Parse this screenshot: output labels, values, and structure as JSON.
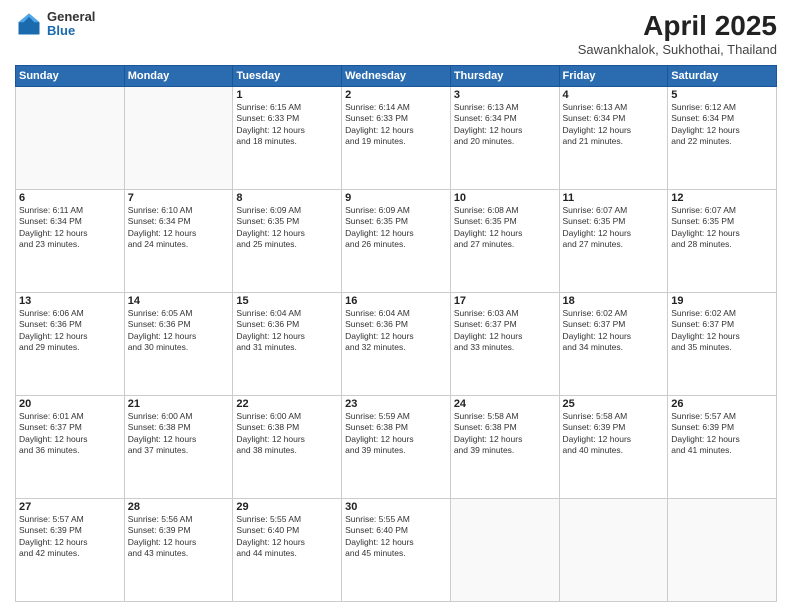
{
  "logo": {
    "general": "General",
    "blue": "Blue"
  },
  "header": {
    "title": "April 2025",
    "subtitle": "Sawankhalok, Sukhothai, Thailand"
  },
  "weekdays": [
    "Sunday",
    "Monday",
    "Tuesday",
    "Wednesday",
    "Thursday",
    "Friday",
    "Saturday"
  ],
  "weeks": [
    [
      {
        "day": "",
        "info": ""
      },
      {
        "day": "",
        "info": ""
      },
      {
        "day": "1",
        "info": "Sunrise: 6:15 AM\nSunset: 6:33 PM\nDaylight: 12 hours\nand 18 minutes."
      },
      {
        "day": "2",
        "info": "Sunrise: 6:14 AM\nSunset: 6:33 PM\nDaylight: 12 hours\nand 19 minutes."
      },
      {
        "day": "3",
        "info": "Sunrise: 6:13 AM\nSunset: 6:34 PM\nDaylight: 12 hours\nand 20 minutes."
      },
      {
        "day": "4",
        "info": "Sunrise: 6:13 AM\nSunset: 6:34 PM\nDaylight: 12 hours\nand 21 minutes."
      },
      {
        "day": "5",
        "info": "Sunrise: 6:12 AM\nSunset: 6:34 PM\nDaylight: 12 hours\nand 22 minutes."
      }
    ],
    [
      {
        "day": "6",
        "info": "Sunrise: 6:11 AM\nSunset: 6:34 PM\nDaylight: 12 hours\nand 23 minutes."
      },
      {
        "day": "7",
        "info": "Sunrise: 6:10 AM\nSunset: 6:34 PM\nDaylight: 12 hours\nand 24 minutes."
      },
      {
        "day": "8",
        "info": "Sunrise: 6:09 AM\nSunset: 6:35 PM\nDaylight: 12 hours\nand 25 minutes."
      },
      {
        "day": "9",
        "info": "Sunrise: 6:09 AM\nSunset: 6:35 PM\nDaylight: 12 hours\nand 26 minutes."
      },
      {
        "day": "10",
        "info": "Sunrise: 6:08 AM\nSunset: 6:35 PM\nDaylight: 12 hours\nand 27 minutes."
      },
      {
        "day": "11",
        "info": "Sunrise: 6:07 AM\nSunset: 6:35 PM\nDaylight: 12 hours\nand 27 minutes."
      },
      {
        "day": "12",
        "info": "Sunrise: 6:07 AM\nSunset: 6:35 PM\nDaylight: 12 hours\nand 28 minutes."
      }
    ],
    [
      {
        "day": "13",
        "info": "Sunrise: 6:06 AM\nSunset: 6:36 PM\nDaylight: 12 hours\nand 29 minutes."
      },
      {
        "day": "14",
        "info": "Sunrise: 6:05 AM\nSunset: 6:36 PM\nDaylight: 12 hours\nand 30 minutes."
      },
      {
        "day": "15",
        "info": "Sunrise: 6:04 AM\nSunset: 6:36 PM\nDaylight: 12 hours\nand 31 minutes."
      },
      {
        "day": "16",
        "info": "Sunrise: 6:04 AM\nSunset: 6:36 PM\nDaylight: 12 hours\nand 32 minutes."
      },
      {
        "day": "17",
        "info": "Sunrise: 6:03 AM\nSunset: 6:37 PM\nDaylight: 12 hours\nand 33 minutes."
      },
      {
        "day": "18",
        "info": "Sunrise: 6:02 AM\nSunset: 6:37 PM\nDaylight: 12 hours\nand 34 minutes."
      },
      {
        "day": "19",
        "info": "Sunrise: 6:02 AM\nSunset: 6:37 PM\nDaylight: 12 hours\nand 35 minutes."
      }
    ],
    [
      {
        "day": "20",
        "info": "Sunrise: 6:01 AM\nSunset: 6:37 PM\nDaylight: 12 hours\nand 36 minutes."
      },
      {
        "day": "21",
        "info": "Sunrise: 6:00 AM\nSunset: 6:38 PM\nDaylight: 12 hours\nand 37 minutes."
      },
      {
        "day": "22",
        "info": "Sunrise: 6:00 AM\nSunset: 6:38 PM\nDaylight: 12 hours\nand 38 minutes."
      },
      {
        "day": "23",
        "info": "Sunrise: 5:59 AM\nSunset: 6:38 PM\nDaylight: 12 hours\nand 39 minutes."
      },
      {
        "day": "24",
        "info": "Sunrise: 5:58 AM\nSunset: 6:38 PM\nDaylight: 12 hours\nand 39 minutes."
      },
      {
        "day": "25",
        "info": "Sunrise: 5:58 AM\nSunset: 6:39 PM\nDaylight: 12 hours\nand 40 minutes."
      },
      {
        "day": "26",
        "info": "Sunrise: 5:57 AM\nSunset: 6:39 PM\nDaylight: 12 hours\nand 41 minutes."
      }
    ],
    [
      {
        "day": "27",
        "info": "Sunrise: 5:57 AM\nSunset: 6:39 PM\nDaylight: 12 hours\nand 42 minutes."
      },
      {
        "day": "28",
        "info": "Sunrise: 5:56 AM\nSunset: 6:39 PM\nDaylight: 12 hours\nand 43 minutes."
      },
      {
        "day": "29",
        "info": "Sunrise: 5:55 AM\nSunset: 6:40 PM\nDaylight: 12 hours\nand 44 minutes."
      },
      {
        "day": "30",
        "info": "Sunrise: 5:55 AM\nSunset: 6:40 PM\nDaylight: 12 hours\nand 45 minutes."
      },
      {
        "day": "",
        "info": ""
      },
      {
        "day": "",
        "info": ""
      },
      {
        "day": "",
        "info": ""
      }
    ]
  ]
}
